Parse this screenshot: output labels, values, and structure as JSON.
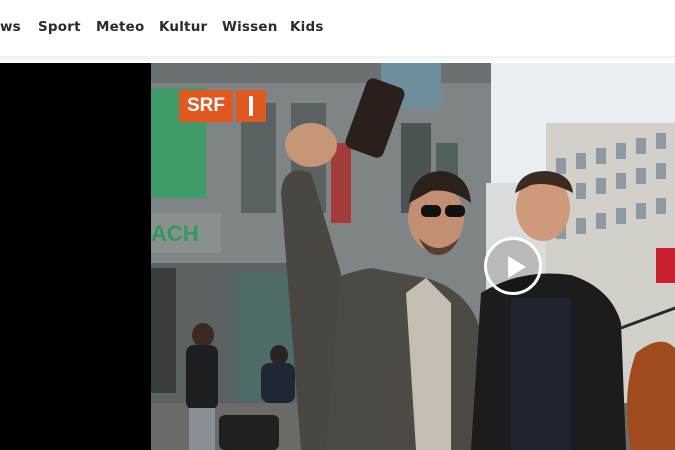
{
  "nav": {
    "items": [
      {
        "label": "ws"
      },
      {
        "label": "Sport"
      },
      {
        "label": "Meteo"
      },
      {
        "label": "Kultur"
      },
      {
        "label": "Wissen"
      },
      {
        "label": "Kids"
      }
    ]
  },
  "video": {
    "logo_text": "SRF",
    "play_icon": "play-icon",
    "sign_text": "ACH",
    "colors": {
      "brand": "#e2591f",
      "sign_green": "#2e9c5b"
    }
  }
}
